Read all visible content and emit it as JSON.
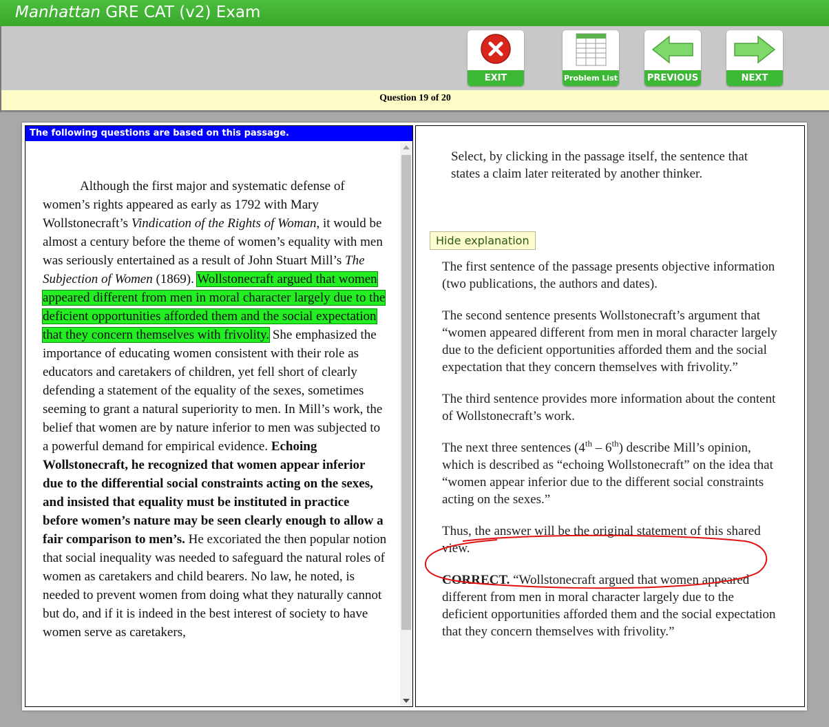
{
  "app": {
    "title_brand": "Manhattan",
    "title_rest": " GRE CAT (v2) Exam"
  },
  "toolbar": {
    "exit_label": "EXIT",
    "problem_list_label": "Problem List",
    "previous_label": "PREVIOUS",
    "next_label": "NEXT"
  },
  "question_counter": "Question 19 of 20",
  "passage": {
    "header": "The following questions are based on this passage.",
    "s1a": "Although the first major and systematic defense of women’s rights appeared as early as 1792 with Mary Wollstonecraft’s ",
    "s1_title1": "Vindication of the Rights of Woman",
    "s1b": ", it would be almost a century before the theme of women’s equality with men was seriously entertained as a result of John Stuart Mill’s ",
    "s1_title2": "The Subjection of Women",
    "s1c": " (1869). ",
    "s2_highlighted": "Wollstonecraft argued that women appeared different from men in moral character largely due to the deficient opportunities afforded them and the social expectation that they concern themselves with frivolity.",
    "s3": " She emphasized the importance of educating women consistent with their role as educators and caretakers of children, yet fell short of clearly defending a statement of the equality of the sexes, sometimes seeming to grant a natural superiority to men. In Mill’s work, the belief that women are by nature inferior to men was subjected to a powerful demand for empirical evidence. ",
    "s_bold": "Echoing Wollstonecraft, he recognized that women appear inferior due to the differential social constraints acting on the sexes, and insisted that equality must be instituted in practice before women’s nature may be seen clearly enough to allow a fair comparison to men’s.",
    "s_rest": " He excoriated the then popular notion that social inequality was needed to safeguard the natural roles of women as caretakers and child bearers. No law, he noted, is needed to prevent women from doing what they naturally cannot but do, and if it is indeed in the best interest of society to have women serve as caretakers,"
  },
  "question": {
    "prompt": "Select, by clicking in the passage itself, the sentence that states a claim later reiterated by another thinker."
  },
  "explanation": {
    "toggle_label": "Hide explanation",
    "p1": "The first sentence of the passage presents objective information (two publications, the authors and dates).",
    "p2": "The second sentence presents Wollstonecraft’s argument that “women appeared different from men in moral character largely due to the deficient opportunities afforded them and the social expectation that they concern themselves with frivolity.”",
    "p3": "The third sentence provides more information about the content of Wollstonecraft’s work.",
    "p4a": "The next three sentences (4",
    "p4_sup1": "th",
    "p4b": " – 6",
    "p4_sup2": "th",
    "p4c": ") describe Mill’s opinion, which is described as “echoing Wollstonecraft” on the idea that “women appear inferior due to the different social constraints acting on the sexes.”",
    "p5": "Thus, the answer will be the original statement of this shared view.",
    "p6_label": "CORRECT.",
    "p6": " “Wollstonecraft argued that women appeared different from men in moral character largely due to the deficient opportunities afforded them and the social expectation that they concern themselves with frivolity.”"
  },
  "colors": {
    "green": "#3db736",
    "blue_header": "#0000ff",
    "highlight": "#22ee22",
    "annotation": "#e01010"
  },
  "icons": {
    "exit": "close-x-icon",
    "problem_list": "grid-list-icon",
    "previous": "arrow-left-icon",
    "next": "arrow-right-icon"
  }
}
